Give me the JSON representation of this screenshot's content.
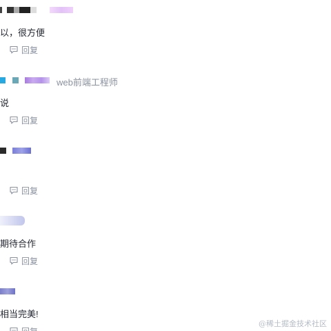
{
  "comments": [
    {
      "author_title": "",
      "text": "以，很方便",
      "reply_label": "回复"
    },
    {
      "author_title": "web前端工程师",
      "text": "说",
      "reply_label": "回复"
    },
    {
      "author_title": "",
      "text": "",
      "reply_label": "回复"
    },
    {
      "author_title": "",
      "text": "期待合作",
      "reply_label": "回复"
    },
    {
      "author_title": "",
      "text": "相当完美!",
      "reply_label": "回复"
    }
  ],
  "watermark": "@稀土掘金技术社区",
  "icons": {
    "reply": "comment-bubble-icon"
  },
  "colors": {
    "text": "#252933",
    "muted": "#8a919f"
  }
}
